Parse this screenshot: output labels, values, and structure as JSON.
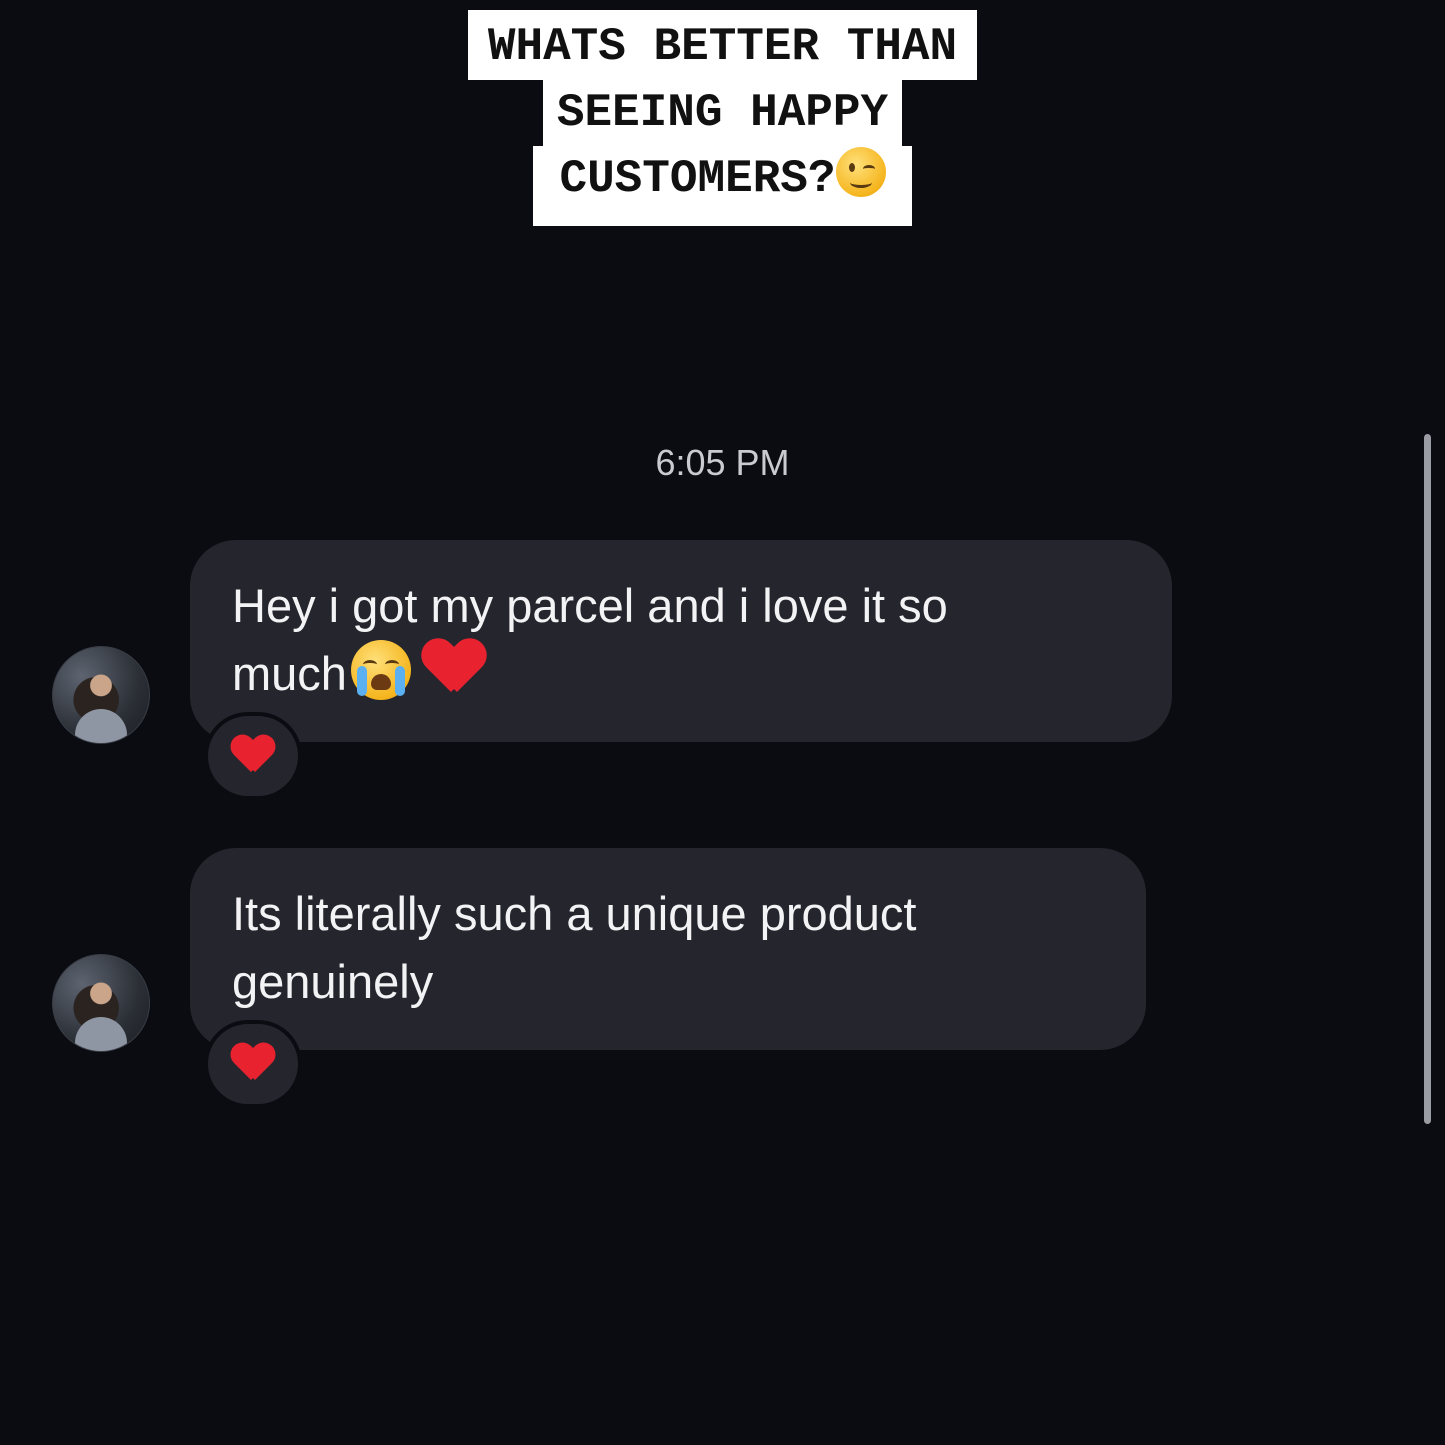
{
  "caption": {
    "lines": [
      "WHATS BETTER THAN",
      "SEEING HAPPY",
      "CUSTOMERS?"
    ],
    "emoji": "winking-face"
  },
  "conversation": {
    "timestamp": "6:05 PM",
    "messages": [
      {
        "lines": [
          "Hey i got my parcel and i love it so",
          "much"
        ],
        "trailing_emojis": [
          "loudly-crying-face",
          "red-heart"
        ],
        "reaction": "red-heart"
      },
      {
        "lines": [
          "Its literally such a unique product",
          "genuinely"
        ],
        "trailing_emojis": [],
        "reaction": "red-heart"
      }
    ]
  },
  "colors": {
    "background": "#0a0c12",
    "bubble": "#25262d",
    "heart": "#e8232f",
    "caption_bg": "#ffffff"
  }
}
